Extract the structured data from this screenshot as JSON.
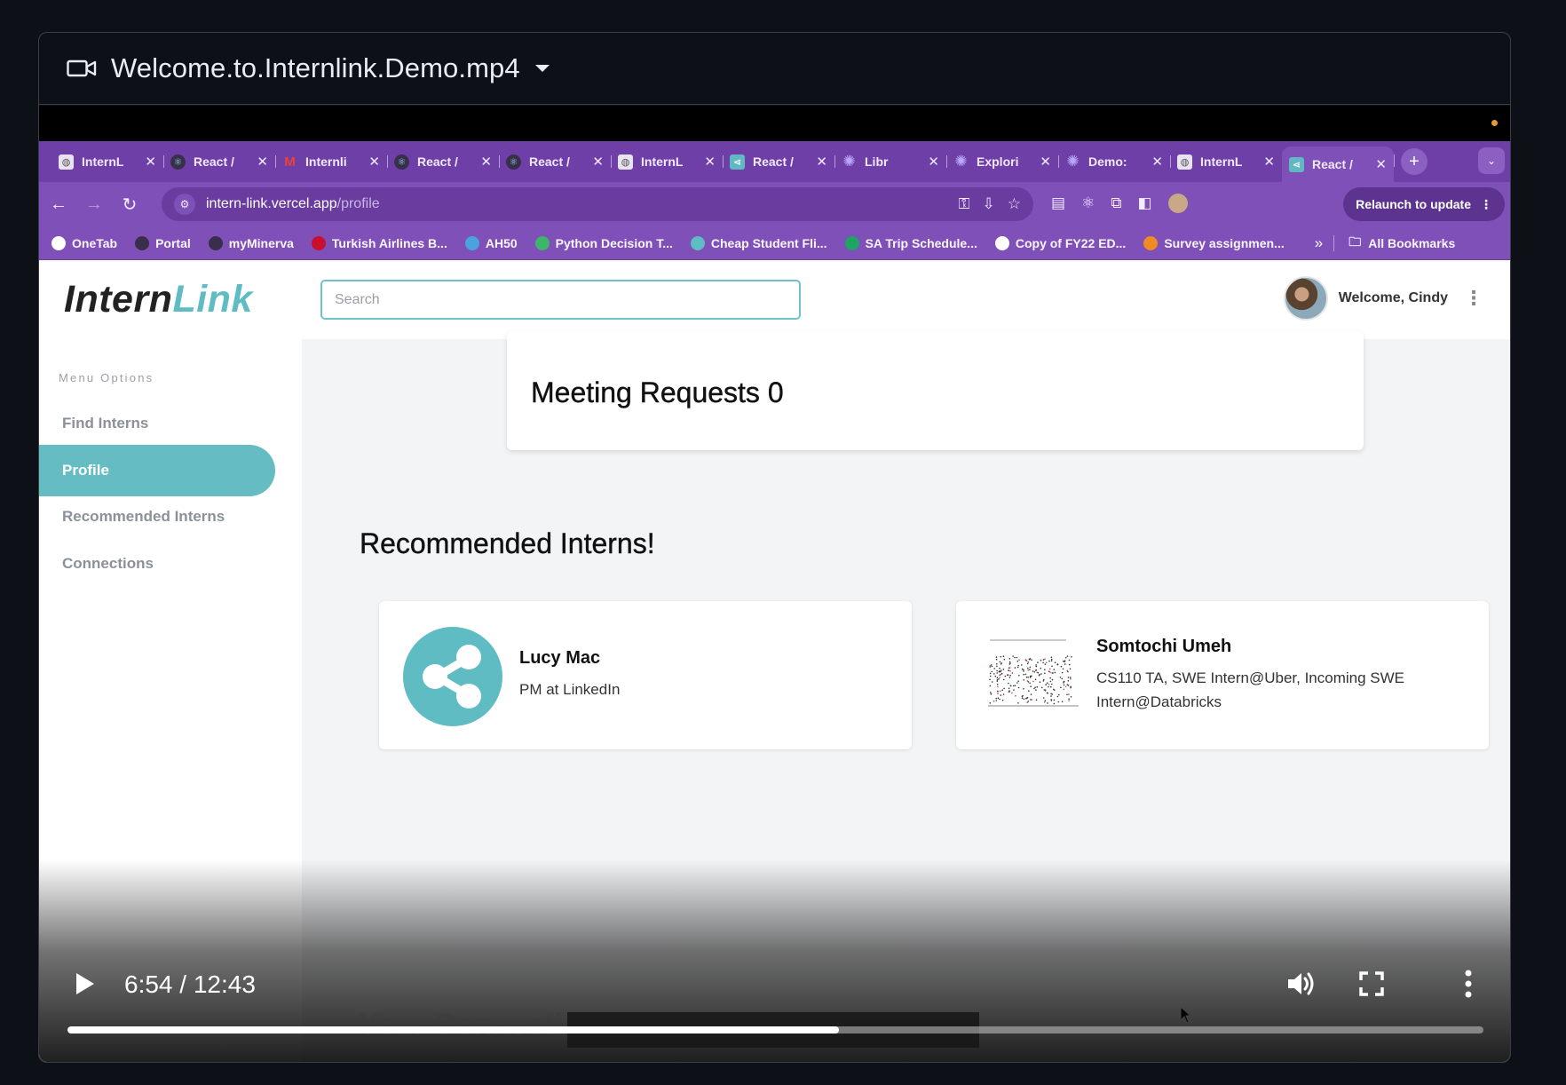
{
  "viewer": {
    "file_name": "Welcome.to.Internlink.Demo.mp4",
    "icon": "video-camera-icon"
  },
  "browser": {
    "tabs": [
      {
        "label": "InternL",
        "icon": "internlink-favicon",
        "type": "plain"
      },
      {
        "label": "React /",
        "icon": "react-favicon",
        "type": "react"
      },
      {
        "label": "Internli",
        "icon": "gmail-favicon",
        "type": "gmail"
      },
      {
        "label": "React /",
        "icon": "react-favicon",
        "type": "react"
      },
      {
        "label": "React /",
        "icon": "react-favicon",
        "type": "react"
      },
      {
        "label": "InternL",
        "icon": "internlink-favicon",
        "type": "plain"
      },
      {
        "label": "React /",
        "icon": "share-favicon",
        "type": "share"
      },
      {
        "label": "Libr",
        "icon": "gear-favicon",
        "type": "gear"
      },
      {
        "label": "Explori",
        "icon": "gear-favicon",
        "type": "gear"
      },
      {
        "label": "Demo:",
        "icon": "gear-favicon",
        "type": "gear"
      },
      {
        "label": "InternL",
        "icon": "internlink-favicon",
        "type": "plain"
      },
      {
        "label": "React /",
        "icon": "share-favicon",
        "type": "share",
        "active": true
      }
    ],
    "url_host": "intern-link.vercel.app",
    "url_path": "/profile",
    "relaunch_label": "Relaunch to update",
    "bookmarks": [
      {
        "label": "OneTab",
        "color": "#ffffff"
      },
      {
        "label": "Portal",
        "color": "#3a2f4a"
      },
      {
        "label": "myMinerva",
        "color": "#3a2f4a"
      },
      {
        "label": "Turkish Airlines B...",
        "color": "#c8102e"
      },
      {
        "label": "AH50",
        "color": "#4aa3df"
      },
      {
        "label": "Python Decision T...",
        "color": "#3fb56b"
      },
      {
        "label": "Cheap Student Fli...",
        "color": "#5fbcc3"
      },
      {
        "label": "SA Trip Schedule...",
        "color": "#1fa463"
      },
      {
        "label": "Copy of FY22 ED...",
        "color": "#ffffff"
      },
      {
        "label": "Survey assignmen...",
        "color": "#f08a24"
      }
    ],
    "all_bookmarks_label": "All Bookmarks"
  },
  "app": {
    "logo_part1": "Intern",
    "logo_part2": "Link",
    "search_placeholder": "Search",
    "welcome": "Welcome, Cindy",
    "menu_title": "Menu Options",
    "menu": [
      "Find Interns",
      "Profile",
      "Recommended Interns",
      "Connections"
    ],
    "active_menu_index": 1,
    "meeting_requests": "Meeting Requests 0",
    "recommended_title": "Recommended Interns!",
    "interns": [
      {
        "name": "Lucy Mac",
        "description": "PM at LinkedIn",
        "avatar": "share-icon"
      },
      {
        "name": "Somtochi Umeh",
        "description": "CS110 TA, SWE Intern@Uber, Incoming SWE Intern@Databricks",
        "avatar": "scatter-plot-thumbnail"
      }
    ],
    "partial_heading": "Your Connectio"
  },
  "player": {
    "current_time": "6:54",
    "duration": "12:43",
    "time_display": "6:54 / 12:43",
    "progress_fraction": 0.545
  },
  "colors": {
    "accent_teal": "#65bdc3",
    "browser_purple": "#7e50b8"
  }
}
